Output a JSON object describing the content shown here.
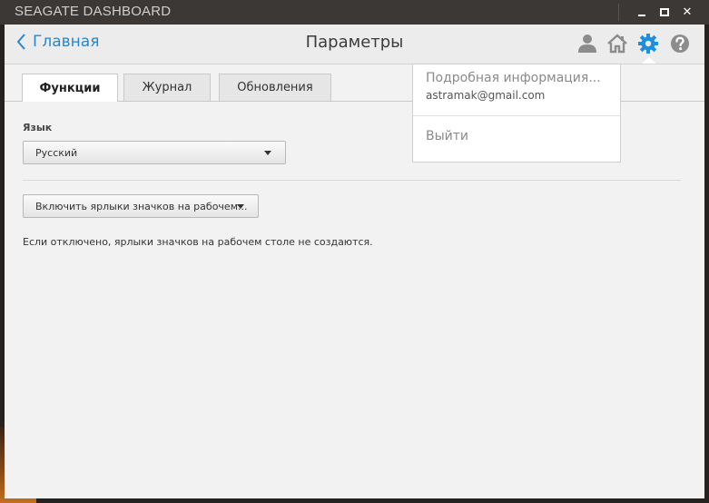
{
  "window": {
    "title": "SEAGATE DASHBOARD",
    "close_glyph": "✕"
  },
  "header": {
    "back_label": "Главная",
    "title": "Параметры",
    "icons": [
      "user-icon",
      "home-icon",
      "gear-icon",
      "help-icon"
    ],
    "accent_color": "#2a86d0"
  },
  "tabs": [
    {
      "label": "Функции",
      "active": true
    },
    {
      "label": "Журнал",
      "active": false
    },
    {
      "label": "Обновления",
      "active": false
    }
  ],
  "settings": {
    "language_label": "Язык",
    "language_value": "Русский",
    "shortcut_value": "Включить ярлыки значков на рабочем...",
    "shortcut_note": "Если отключено, ярлыки значков на рабочем столе не создаются."
  },
  "account_menu": {
    "details_label": "Подробная информация...",
    "email": "astramak@gmail.com",
    "logout_label": "Выйти"
  }
}
